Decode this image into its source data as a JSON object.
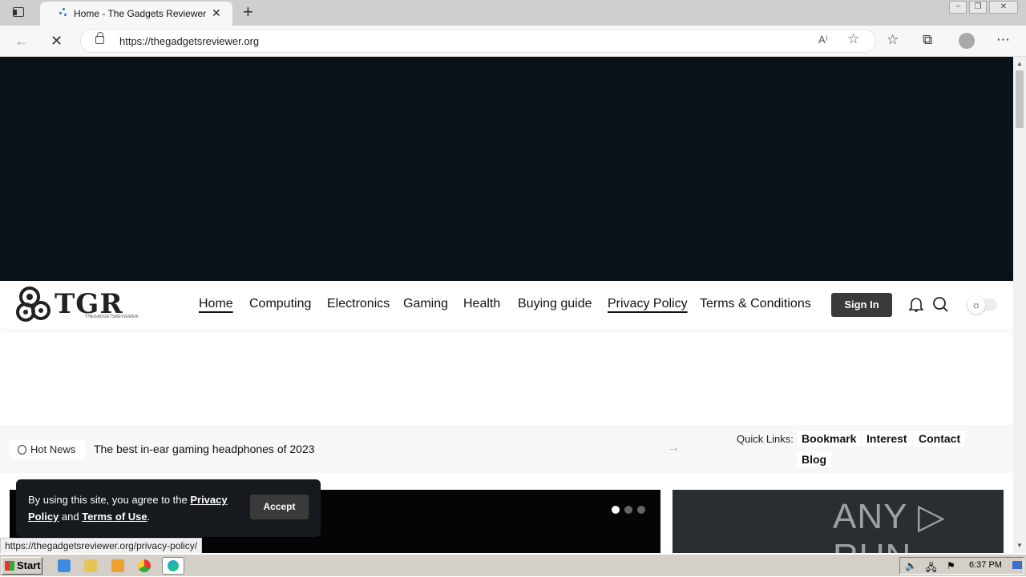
{
  "browser": {
    "tab_title": "Home - The Gadgets Reviewer",
    "url": "https://thegadgetsreviewer.org",
    "read_aloud": "A⁾",
    "window_buttons": [
      "−",
      "❐",
      "✕"
    ]
  },
  "site": {
    "logo_text": "TGR",
    "logo_sub": "THEGADGETSREVIEWER",
    "menu": [
      {
        "label": "Home",
        "active": true
      },
      {
        "label": "Computing",
        "active": false
      },
      {
        "label": "Electronics",
        "active": false
      },
      {
        "label": "Gaming",
        "active": false
      },
      {
        "label": "Health",
        "active": false
      },
      {
        "label": "Buying guide",
        "active": false
      },
      {
        "label": "Privacy Policy",
        "active": true
      },
      {
        "label": "Terms & Conditions",
        "active": false
      }
    ],
    "sign_in": "Sign In",
    "hot_news_label": "Hot News",
    "hot_news_headline": "The best in-ear gaming headphones of 2023",
    "quick_links_label": "Quick Links:",
    "quick_links": [
      "Bookmark",
      "Interest",
      "Contact",
      "Blog"
    ],
    "watermark": "ANY ▷ RUN"
  },
  "cookie": {
    "prefix": "By using this site, you agree to the ",
    "privacy": "Privacy Policy",
    "and": " and ",
    "terms": "Terms of Use",
    "suffix": ".",
    "accept": "Accept"
  },
  "status_url": "https://thegadgetsreviewer.org/privacy-policy/",
  "taskbar": {
    "start": "Start",
    "clock": "6:37 PM"
  },
  "colors": {
    "ad_bg": "#0b1118",
    "dark_button": "#3a3a3a",
    "cookie_bg": "#16191d"
  }
}
